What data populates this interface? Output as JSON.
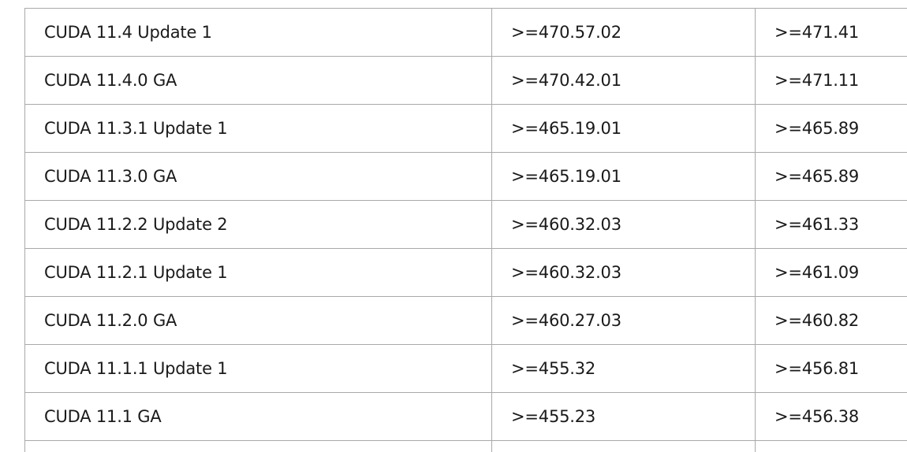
{
  "table": {
    "rows": [
      {
        "version": "CUDA 11.4 Update 1",
        "linux_driver": ">=470.57.02",
        "windows_driver": ">=471.41"
      },
      {
        "version": "CUDA 11.4.0 GA",
        "linux_driver": ">=470.42.01",
        "windows_driver": ">=471.11"
      },
      {
        "version": "CUDA 11.3.1 Update 1",
        "linux_driver": ">=465.19.01",
        "windows_driver": ">=465.89"
      },
      {
        "version": "CUDA 11.3.0 GA",
        "linux_driver": ">=465.19.01",
        "windows_driver": ">=465.89"
      },
      {
        "version": "CUDA 11.2.2 Update 2",
        "linux_driver": ">=460.32.03",
        "windows_driver": ">=461.33"
      },
      {
        "version": "CUDA 11.2.1 Update 1",
        "linux_driver": ">=460.32.03",
        "windows_driver": ">=461.09"
      },
      {
        "version": "CUDA 11.2.0 GA",
        "linux_driver": ">=460.27.03",
        "windows_driver": ">=460.82"
      },
      {
        "version": "CUDA 11.1.1 Update 1",
        "linux_driver": ">=455.32",
        "windows_driver": ">=456.81"
      },
      {
        "version": "CUDA 11.1 GA",
        "linux_driver": ">=455.23",
        "windows_driver": ">=456.38"
      }
    ]
  }
}
